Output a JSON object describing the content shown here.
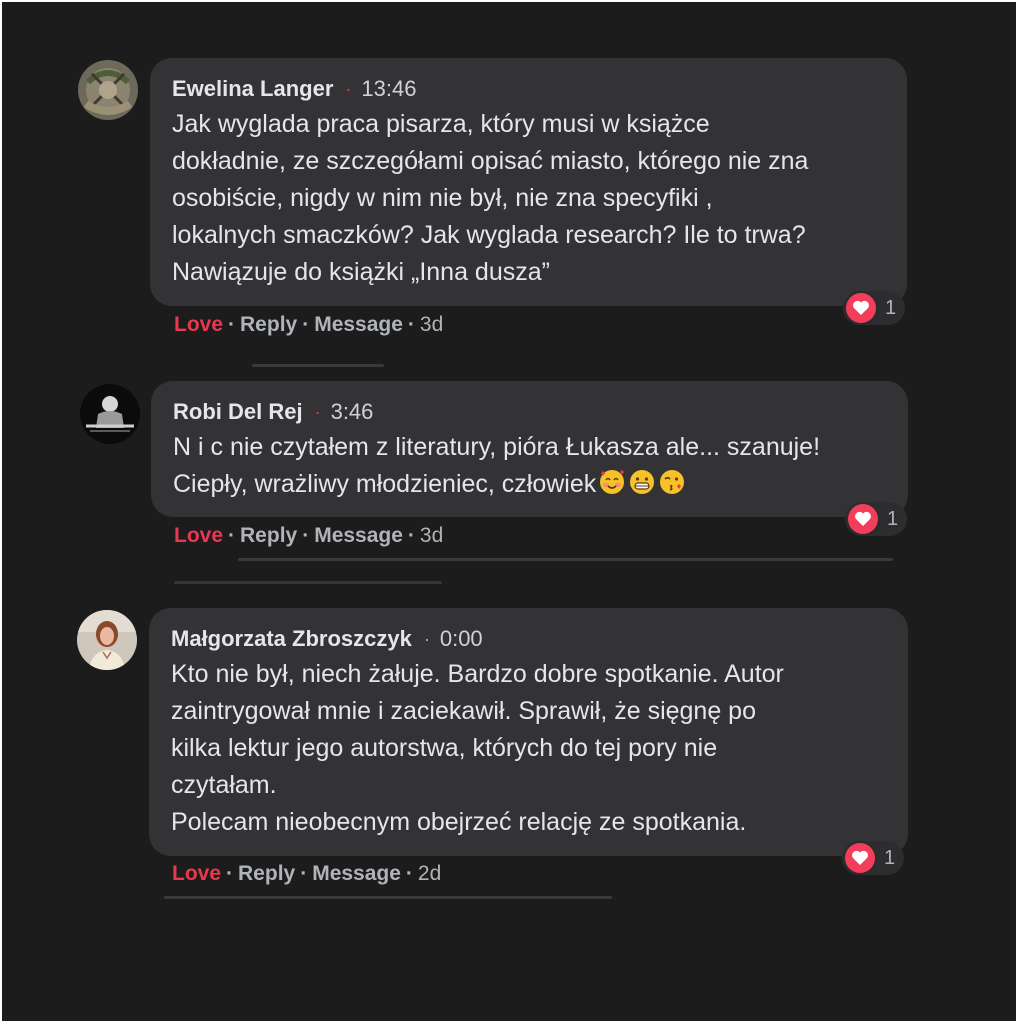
{
  "comments": [
    {
      "author": "Ewelina Langer",
      "time": "13:46",
      "text": "Jak wyglada praca pisarza, który musi w książce\ndokładnie, ze szczegółami opisać miasto, którego nie zna\nosobiście, nigdy w nim nie był, nie zna specyfiki ,\nlokalnych smaczków? Jak wyglada research? Ile to trwa?\nNawiązuje do książki „Inna dusza”",
      "reaction_icon": "heart-icon",
      "reaction_count": "1",
      "actions": {
        "love": "Love",
        "reply": "Reply",
        "message": "Message",
        "age": "3d"
      }
    },
    {
      "author": "Robi Del Rej",
      "time": "3:46",
      "text": "N i c nie czytałem z literatury, pióra Łukasza ale... szanuje!\nCiepły, wrażliwy młodzieniec, człowiek",
      "emojis": [
        "smiling-face-with-hearts-icon",
        "grinning-face-icon",
        "face-blowing-kiss-icon"
      ],
      "reaction_icon": "heart-icon",
      "reaction_count": "1",
      "actions": {
        "love": "Love",
        "reply": "Reply",
        "message": "Message",
        "age": "3d"
      }
    },
    {
      "author": "Małgorzata Zbroszczyk",
      "time": "0:00",
      "text": "Kto nie był, niech żałuje. Bardzo dobre spotkanie. Autor\nzaintrygował mnie i zaciekawił. Sprawił, że sięgnę po\nkilka lektur jego autorstwa, których do tej pory nie\nczytałam.\nPolecam nieobecnym obejrzeć relację ze spotkania.",
      "reaction_icon": "heart-icon",
      "reaction_count": "1",
      "actions": {
        "love": "Love",
        "reply": "Reply",
        "message": "Message",
        "age": "2d"
      }
    }
  ],
  "colors": {
    "background": "#1c1c1d",
    "bubble": "#333335",
    "love": "#e8384f",
    "heart": "#f33e5b",
    "secondary_text": "#b0b3b8",
    "primary_text": "#e4e6eb"
  }
}
